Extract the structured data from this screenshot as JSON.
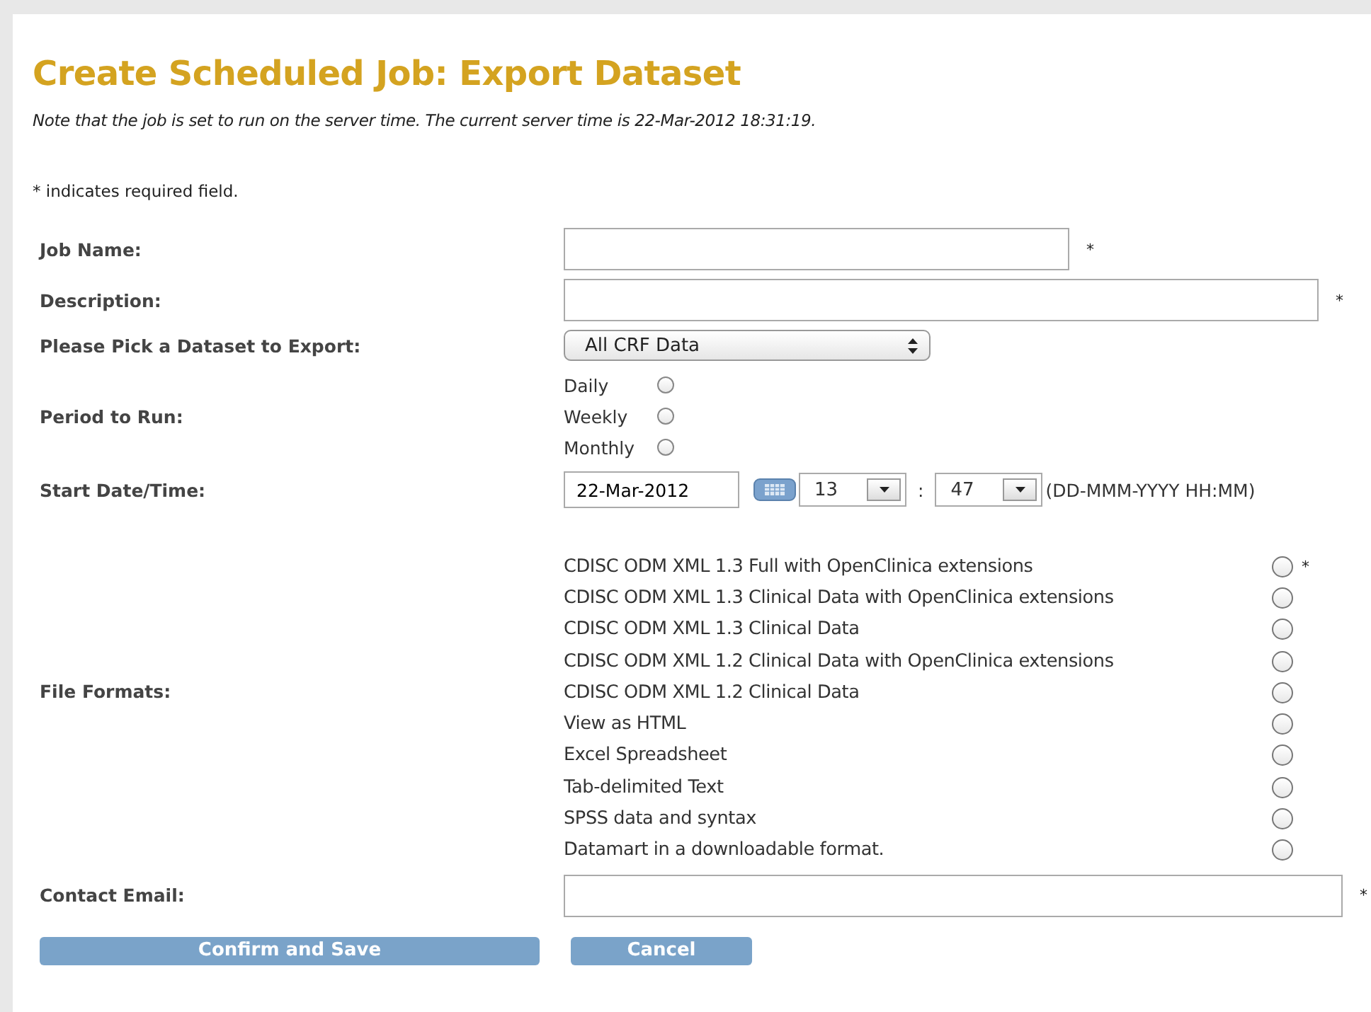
{
  "title": "Create Scheduled Job: Export Dataset",
  "note": "Note that the job is set to run on the server time. The current server time is 22-Mar-2012 18:31:19.",
  "required_note": "* indicates required field.",
  "job_name": {
    "label": "Job Name:",
    "required_mark": "*"
  },
  "description": {
    "label": "Description:",
    "required_mark": "*"
  },
  "dataset": {
    "label": "Please Pick a Dataset to Export:",
    "value": "All CRF Data"
  },
  "period": {
    "label": "Period to Run:",
    "options": [
      {
        "label": "Daily",
        "selected": false
      },
      {
        "label": "Weekly",
        "selected": false
      },
      {
        "label": "Monthly",
        "selected": false
      }
    ]
  },
  "start": {
    "label": "Start Date/Time:",
    "date": "22-Mar-2012",
    "hour": "13",
    "separator": ":",
    "minute": "47",
    "format_hint": "(DD-MMM-YYYY HH:MM)"
  },
  "file_formats": {
    "label": "File Formats:",
    "required_mark": "*",
    "options": [
      {
        "label": "CDISC ODM XML 1.3 Full with OpenClinica extensions",
        "selected": false
      },
      {
        "label": "CDISC ODM XML 1.3 Clinical Data with OpenClinica extensions",
        "selected": false
      },
      {
        "label": "CDISC ODM XML 1.3 Clinical Data",
        "selected": false
      },
      {
        "label": "CDISC ODM XML 1.2 Clinical Data with OpenClinica extensions",
        "selected": false
      },
      {
        "label": "CDISC ODM XML 1.2 Clinical Data",
        "selected": false
      },
      {
        "label": "View as HTML",
        "selected": false
      },
      {
        "label": "Excel Spreadsheet",
        "selected": false
      },
      {
        "label": "Tab-delimited Text",
        "selected": false
      },
      {
        "label": "SPSS data and syntax",
        "selected": false
      },
      {
        "label": "Datamart in a downloadable format.",
        "selected": false
      }
    ]
  },
  "contact_email": {
    "label": "Contact Email:",
    "required_mark": "*"
  },
  "buttons": [
    "Confirm and Save",
    "Cancel"
  ]
}
